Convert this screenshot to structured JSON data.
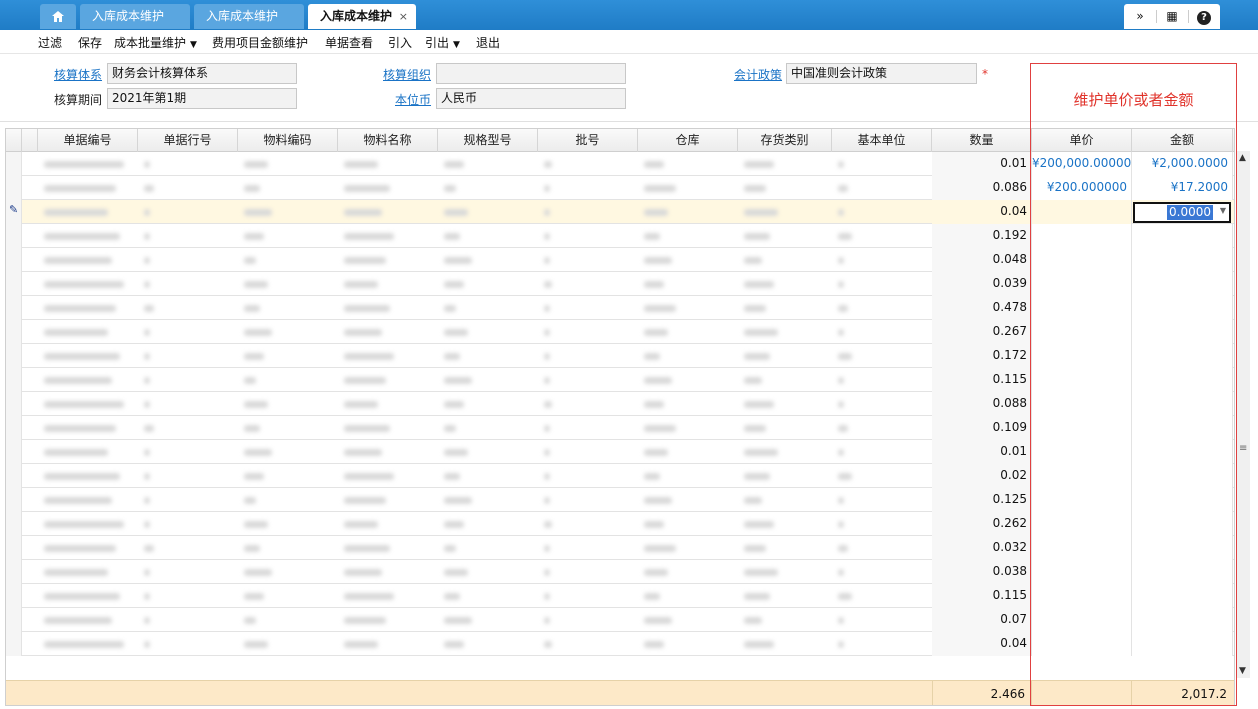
{
  "tabs": {
    "home_icon": "home-icon",
    "items": [
      "入库成本维护",
      "入库成本维护",
      "入库成本维护"
    ],
    "active_close": "×"
  },
  "window_controls": {
    "collapse": "»",
    "grid": "▦",
    "help": "?"
  },
  "toolbar": {
    "filter": "过滤",
    "save": "保存",
    "batch_maintain": "成本批量维护",
    "fee_amount": "费用项目金额维护",
    "doc_view": "单据查看",
    "import": "引入",
    "export": "引出",
    "exit": "退出"
  },
  "form": {
    "accounting_system_label": "核算体系",
    "accounting_system_value": "财务会计核算体系",
    "accounting_org_label": "核算组织",
    "accounting_org_value": "",
    "policy_label": "会计政策",
    "policy_value": "中国准则会计政策",
    "required_mark": "*",
    "period_label": "核算期间",
    "period_value": "2021年第1期",
    "currency_label": "本位币",
    "currency_value": "人民币"
  },
  "annotation": "维护单价或者金额",
  "grid": {
    "headers": {
      "doc_no": "单据编号",
      "line_no": "单据行号",
      "material_code": "物料编码",
      "material_name": "物料名称",
      "spec": "规格型号",
      "lot": "批号",
      "warehouse": "仓库",
      "stock_type": "存货类别",
      "base_unit": "基本单位",
      "qty": "数量",
      "price": "单价",
      "amount": "金额"
    },
    "rows": [
      {
        "qty": "0.01",
        "price": "¥200,000.00000",
        "amount": "¥2,000.0000"
      },
      {
        "qty": "0.086",
        "price": "¥200.000000",
        "amount": "¥17.2000"
      },
      {
        "qty": "0.04",
        "price": "",
        "amount": "0.0000",
        "editing": true
      },
      {
        "qty": "0.192",
        "price": "",
        "amount": ""
      },
      {
        "qty": "0.048",
        "price": "",
        "amount": ""
      },
      {
        "qty": "0.039",
        "price": "",
        "amount": ""
      },
      {
        "qty": "0.478",
        "price": "",
        "amount": ""
      },
      {
        "qty": "0.267",
        "price": "",
        "amount": ""
      },
      {
        "qty": "0.172",
        "price": "",
        "amount": ""
      },
      {
        "qty": "0.115",
        "price": "",
        "amount": ""
      },
      {
        "qty": "0.088",
        "price": "",
        "amount": ""
      },
      {
        "qty": "0.109",
        "price": "",
        "amount": ""
      },
      {
        "qty": "0.01",
        "price": "",
        "amount": ""
      },
      {
        "qty": "0.02",
        "price": "",
        "amount": ""
      },
      {
        "qty": "0.125",
        "price": "",
        "amount": ""
      },
      {
        "qty": "0.262",
        "price": "",
        "amount": ""
      },
      {
        "qty": "0.032",
        "price": "",
        "amount": ""
      },
      {
        "qty": "0.038",
        "price": "",
        "amount": ""
      },
      {
        "qty": "0.115",
        "price": "",
        "amount": ""
      },
      {
        "qty": "0.07",
        "price": "",
        "amount": ""
      },
      {
        "qty": "0.04",
        "price": "",
        "amount": ""
      }
    ],
    "totals": {
      "qty": "2.466",
      "amount": "2,017.2"
    }
  }
}
